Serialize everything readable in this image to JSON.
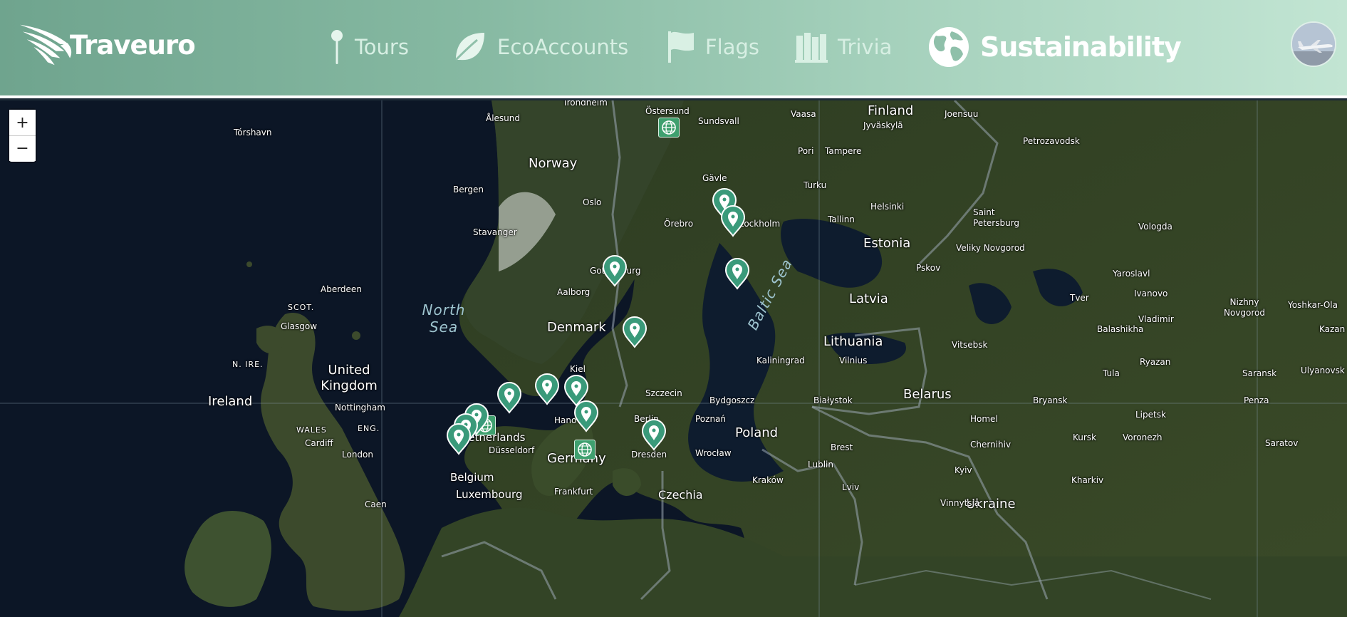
{
  "app": {
    "name": "Traveuro"
  },
  "nav": {
    "tours": "Tours",
    "eco_accounts": "EcoAccounts",
    "flags": "Flags",
    "trivia": "Trivia",
    "sustainability": "Sustainability"
  },
  "map": {
    "zoom_in": "+",
    "zoom_out": "−",
    "labels": {
      "finland": "Finland",
      "norway": "Norway",
      "estonia": "Estonia",
      "latvia": "Latvia",
      "lithuania": "Lithuania",
      "belarus": "Belarus",
      "poland": "Poland",
      "germany": "Germany",
      "denmark": "Denmark",
      "united_kingdom": "United Kingdom",
      "ireland": "Ireland",
      "belgium": "Belgium",
      "netherlands": "Netherlands",
      "luxembourg": "Luxembourg",
      "czechia": "Czechia",
      "ukraine": "Ukraine",
      "north_sea": "North Sea",
      "baltic_sea": "Baltic Sea",
      "scot": "SCOT.",
      "wales": "WALES",
      "eng": "ENG.",
      "n_ire": "N. IRE.",
      "trondheim": "Trondheim",
      "ostersund": "Östersund",
      "vaasa": "Vaasa",
      "joensuu": "Joensuu",
      "alesund": "Ålesund",
      "sundsvall": "Sundsvall",
      "jyvaskyla": "Jyväskylä",
      "torshavn": "Tórshavn",
      "pori": "Pori",
      "tampere": "Tampere",
      "petrozavodsk": "Petrozavodsk",
      "bergen": "Bergen",
      "gavle": "Gävle",
      "turku": "Turku",
      "oslo": "Oslo",
      "helsinki": "Helsinki",
      "saint_petersburg": "Saint Petersburg",
      "stavanger": "Stavanger",
      "orebro": "Örebro",
      "stockholm": "Stockholm",
      "tallinn": "Tallinn",
      "vologda": "Vologda",
      "veliky_novgorod": "Veliky Novgorod",
      "gothenburg": "Gothenburg",
      "pskov": "Pskov",
      "yaroslavl": "Yaroslavl",
      "aberdeen": "Aberdeen",
      "aalborg": "Aalborg",
      "ivanovo": "Ivanovo",
      "tver": "Tver",
      "nizhny_novgorod": "Nizhny Novgorod",
      "yoshkar_ola": "Yoshkar-Ola",
      "glasgow": "Glasgow",
      "vladimir": "Vladimir",
      "balashikha": "Balashikha",
      "kazan": "Kazan",
      "kaliningrad": "Kaliningrad",
      "vilnius": "Vilnius",
      "vitsebsk": "Vitsebsk",
      "kiel": "Kiel",
      "ryazan": "Ryazan",
      "tula": "Tula",
      "saransk": "Saransk",
      "ulyanovsk": "Ulyanovsk",
      "szczecin": "Szczecin",
      "bydgoszcz": "Bydgoszcz",
      "bialystok": "Białystok",
      "bryansk": "Bryansk",
      "penza": "Penza",
      "nottingham": "Nottingham",
      "hanover": "Hanover",
      "berlin": "Berlin",
      "poznan": "Poznań",
      "lipetsk": "Lipetsk",
      "brest": "Brest",
      "homel": "Homel",
      "cardiff": "Cardiff",
      "london": "London",
      "dusseldorf": "Düsseldorf",
      "kursk": "Kursk",
      "voronezh": "Voronezh",
      "saratov": "Saratov",
      "lublin": "Lublin",
      "chernihiv": "Chernihiv",
      "dresden": "Dresden",
      "wroclaw": "Wrocław",
      "kyiv": "Kyiv",
      "kharkiv": "Kharkiv",
      "krakow": "Kraków",
      "lviv": "Lviv",
      "frankfurt": "Frankfurt",
      "vinnytsia": "Vinnytsia",
      "caen": "Caen"
    }
  },
  "colors": {
    "header_start": "#6fa48e",
    "header_end": "#c2e5d3",
    "marker": "#3a9a7a",
    "globe_marker": "#3fa06f"
  }
}
